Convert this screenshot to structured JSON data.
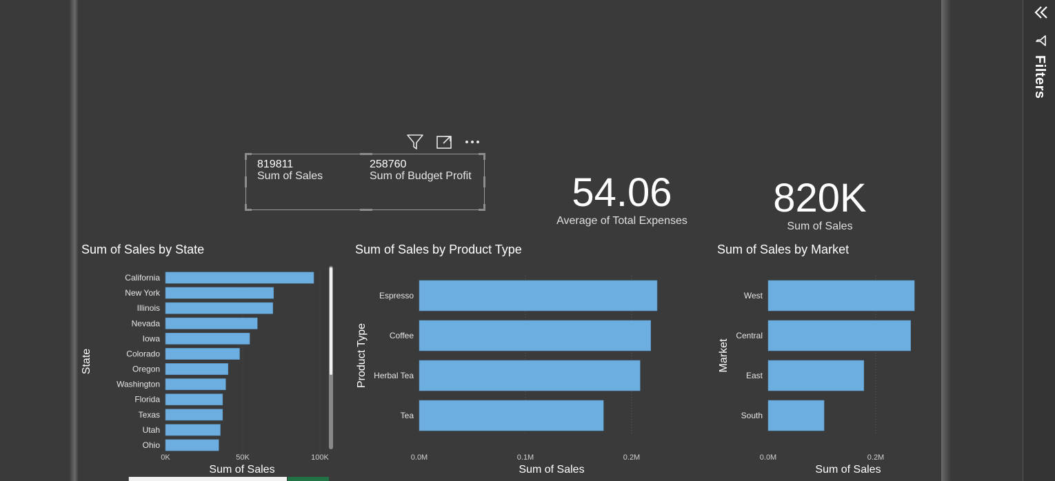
{
  "filters_pane": {
    "label": "Filters"
  },
  "multirow_card": {
    "items": [
      {
        "value": "819811",
        "label": "Sum of Sales"
      },
      {
        "value": "258760",
        "label": "Sum of Budget Profit"
      }
    ]
  },
  "card_expenses": {
    "value": "54.06",
    "label": "Average of Total Expenses"
  },
  "card_sales": {
    "value": "820K",
    "label": "Sum of Sales"
  },
  "colors": {
    "bar": "#6caee0",
    "background": "#3a3a3a",
    "text": "#ffffff",
    "active_tab": "#217346"
  },
  "chart_data": [
    {
      "type": "bar",
      "orientation": "horizontal",
      "title": "Sum of Sales by State",
      "xlabel": "Sum of Sales",
      "ylabel": "State",
      "categories": [
        "California",
        "New York",
        "Illinois",
        "Nevada",
        "Iowa",
        "Colorado",
        "Oregon",
        "Washington",
        "Florida",
        "Texas",
        "Utah",
        "Ohio"
      ],
      "values": [
        96000,
        70000,
        69500,
        59500,
        54500,
        48000,
        40500,
        39000,
        37000,
        37000,
        35500,
        34500
      ],
      "xlim": [
        0,
        100000
      ],
      "xticks": [
        "0K",
        "50K",
        "100K"
      ],
      "grid": true
    },
    {
      "type": "bar",
      "orientation": "horizontal",
      "title": "Sum of Sales by Product Type",
      "xlabel": "Sum of Sales",
      "ylabel": "Product Type",
      "categories": [
        "Espresso",
        "Coffee",
        "Herbal Tea",
        "Tea"
      ],
      "values": [
        224000,
        218000,
        208000,
        173500
      ],
      "xlim": [
        0,
        200000
      ],
      "xticks": [
        "0.0M",
        "0.1M",
        "0.2M"
      ],
      "grid": true
    },
    {
      "type": "bar",
      "orientation": "horizontal",
      "title": "Sum of Sales by Market",
      "xlabel": "Sum of Sales",
      "ylabel": "Market",
      "categories": [
        "West",
        "Central",
        "East",
        "South"
      ],
      "values": [
        272000,
        265000,
        178000,
        104000
      ],
      "xlim": [
        0,
        200000
      ],
      "xticks": [
        "0.0M",
        "0.2M"
      ],
      "grid": true
    }
  ]
}
